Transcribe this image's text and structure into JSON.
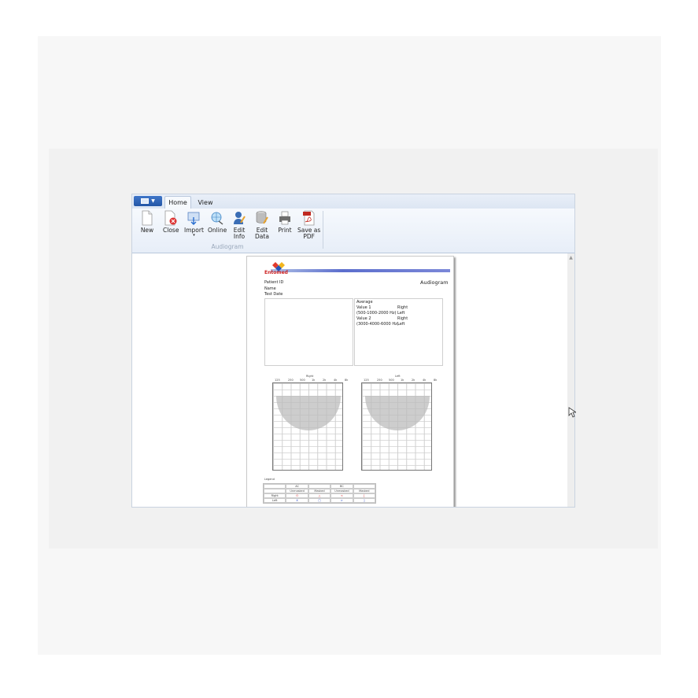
{
  "ribbon": {
    "tabs": [
      {
        "label": "Home",
        "active": true
      },
      {
        "label": "View",
        "active": false
      }
    ],
    "buttons": [
      {
        "label": "New",
        "icon": "new-document-icon"
      },
      {
        "label": "Close",
        "icon": "close-document-icon"
      },
      {
        "label": "Import",
        "icon": "import-icon",
        "has_dropdown": true
      },
      {
        "label": "Online",
        "icon": "online-icon"
      },
      {
        "label": "Edit\nInfo",
        "icon": "edit-info-icon"
      },
      {
        "label": "Edit\nData",
        "icon": "edit-data-icon"
      },
      {
        "label": "Print",
        "icon": "printer-icon"
      },
      {
        "label": "Save as\nPDF",
        "icon": "pdf-icon"
      }
    ],
    "group_label": "Audiogram"
  },
  "report": {
    "logo_text": "Entomed",
    "title": "Audiogram",
    "fields": [
      "Patient ID",
      "Name",
      "Test Date"
    ],
    "average": {
      "heading": "Average",
      "value1_label": "Value 1",
      "value1_range": "(500-1000-2000 Hz)",
      "value1_right": "Right",
      "value1_left": "Left",
      "value2_label": "Value 2",
      "value2_range": "(3000-4000-6000 Hz)",
      "value2_right": "Right",
      "value2_left": "Left"
    },
    "charts": [
      {
        "title": "Right"
      },
      {
        "title": "Left"
      }
    ],
    "freq_ticks": [
      "125",
      "250",
      "500",
      "1k",
      "2k",
      "4k",
      "8k"
    ],
    "legend_label": "Legend",
    "legend_rows": [
      [
        "",
        "AC",
        "",
        "BC",
        ""
      ],
      [
        "",
        "Unmasked",
        "Masked",
        "Unmasked",
        "Masked"
      ],
      [
        "Right",
        "O",
        "△",
        "<",
        "["
      ],
      [
        "Left",
        "X",
        "□",
        ">",
        "]"
      ]
    ]
  },
  "colors": {
    "accent": "#2456a6",
    "ribbon_bg": "#eef3fa",
    "right_ear": "#d22222",
    "left_ear": "#2244cc"
  }
}
